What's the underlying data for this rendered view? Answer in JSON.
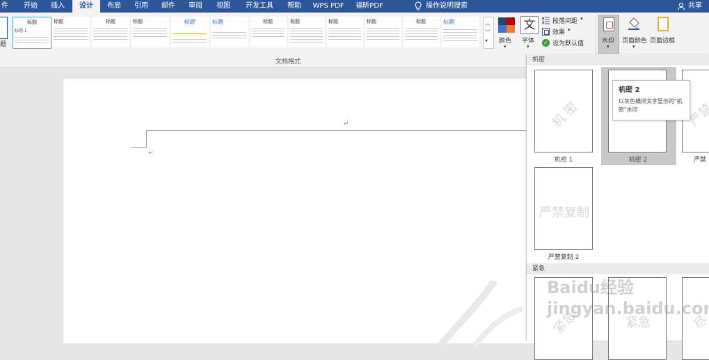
{
  "tabs": [
    "件",
    "开始",
    "插入",
    "设计",
    "布局",
    "引用",
    "邮件",
    "审阅",
    "视图",
    "开发工具",
    "帮助",
    "WPS PDF",
    "福昕PDF"
  ],
  "active_tab": "设计",
  "tell_me": "操作说明搜索",
  "share": "共享",
  "ribbon": {
    "partial_left_label": "题",
    "style_gallery": [
      {
        "title": "标题",
        "sub": "标题 1"
      },
      {
        "title": "标题",
        "sub": ""
      },
      {
        "title": "标题",
        "sub": ""
      },
      {
        "title": "标题",
        "sub": ""
      },
      {
        "title": "标题",
        "sub": ""
      },
      {
        "title": "标题",
        "sub": ""
      },
      {
        "title": "标题",
        "sub": ""
      },
      {
        "title": "标题",
        "sub": ""
      },
      {
        "title": "标题",
        "sub": ""
      },
      {
        "title": "标题",
        "sub": ""
      },
      {
        "title": "标题",
        "sub": ""
      },
      {
        "title": "标题",
        "sub": ""
      }
    ],
    "group_label": "文档格式",
    "colors": "颜色",
    "fonts": "字体",
    "paragraph_spacing": "段落间距",
    "effects": "效果",
    "set_default": "设为默认值",
    "watermark": "水印",
    "page_color": "页面颜色",
    "page_borders": "页面边框"
  },
  "panel": {
    "section1": "机密",
    "items1": [
      {
        "label": "机密 1",
        "text": "机 密"
      },
      {
        "label": "机密 2",
        "text": "机 密"
      },
      {
        "label": "严禁",
        "text": "严禁"
      }
    ],
    "items1b": [
      {
        "label": "严禁复制 2",
        "text": "严禁复制"
      }
    ],
    "section2": "紧急",
    "items2": [
      {
        "label": "",
        "text": "紧急"
      },
      {
        "label": "",
        "text": "紧急"
      },
      {
        "label": "",
        "text": "尽"
      }
    ]
  },
  "tooltip": {
    "title": "机密 2",
    "desc": "以灰色横排文字显示的\"机密\"水印"
  },
  "watermark_overlay": "Baidu经验 jingyan.baidu.com",
  "colors": {
    "accent": "#2b579a"
  }
}
